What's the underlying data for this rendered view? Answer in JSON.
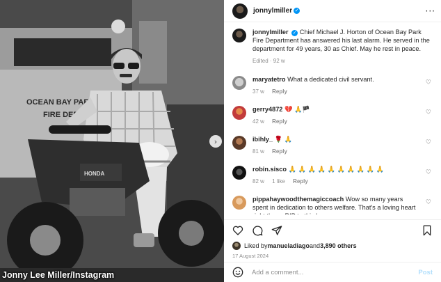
{
  "photo": {
    "credit": "Jonny Lee Miller/Instagram",
    "truck_text_1": "OCEAN BAY PARK",
    "truck_text_2": "FIRE DEPT",
    "bike_brand": "HONDA"
  },
  "header": {
    "username": "jonnylmiller",
    "verified_mark": "✓",
    "more": "···"
  },
  "caption": {
    "username": "jonnylmiller",
    "text": "Chief Michael J. Horton of Ocean Bay Park Fire Department has answered his last alarm. He served in the department for 49 years, 30 as Chief. May he rest in peace.",
    "meta": "Edited · 92 w"
  },
  "comments": [
    {
      "username": "maryatetro",
      "text": "What a dedicated civil servant.",
      "age": "37 w",
      "reply": "Reply",
      "likes": ""
    },
    {
      "username": "gerry4872",
      "text": "💔 🙏🏴",
      "age": "42 w",
      "reply": "Reply",
      "likes": ""
    },
    {
      "username": "ibihly_",
      "text": "🌹 🙏",
      "age": "81 w",
      "reply": "Reply",
      "likes": ""
    },
    {
      "username": "robin.sisco",
      "text": "🙏 🙏 🙏 🙏 🙏 🙏 🙏 🙏 🙏 🙏",
      "age": "82 w",
      "reply": "Reply",
      "likes": "1 like"
    },
    {
      "username": "pippahaywoodthemagiccoach",
      "text": "Wow so many years spent in dedication to others welfare. That's a loving heart right there. RIP to this hero.",
      "age": "",
      "reply": "",
      "likes": ""
    }
  ],
  "likes": {
    "prefix": "Liked by ",
    "user": "manueladiago",
    "middle": " and ",
    "count": "3,890 others"
  },
  "date": "17 August 2024",
  "add_comment": {
    "placeholder": "Add a comment...",
    "post_label": "Post"
  },
  "colors": {
    "accent": "#0095f6",
    "muted": "#8e8e8e",
    "post_disabled": "#b2dffc"
  },
  "icons": [
    "heart-icon",
    "comment-icon",
    "share-icon",
    "bookmark-icon",
    "emoji-icon",
    "more-icon"
  ]
}
